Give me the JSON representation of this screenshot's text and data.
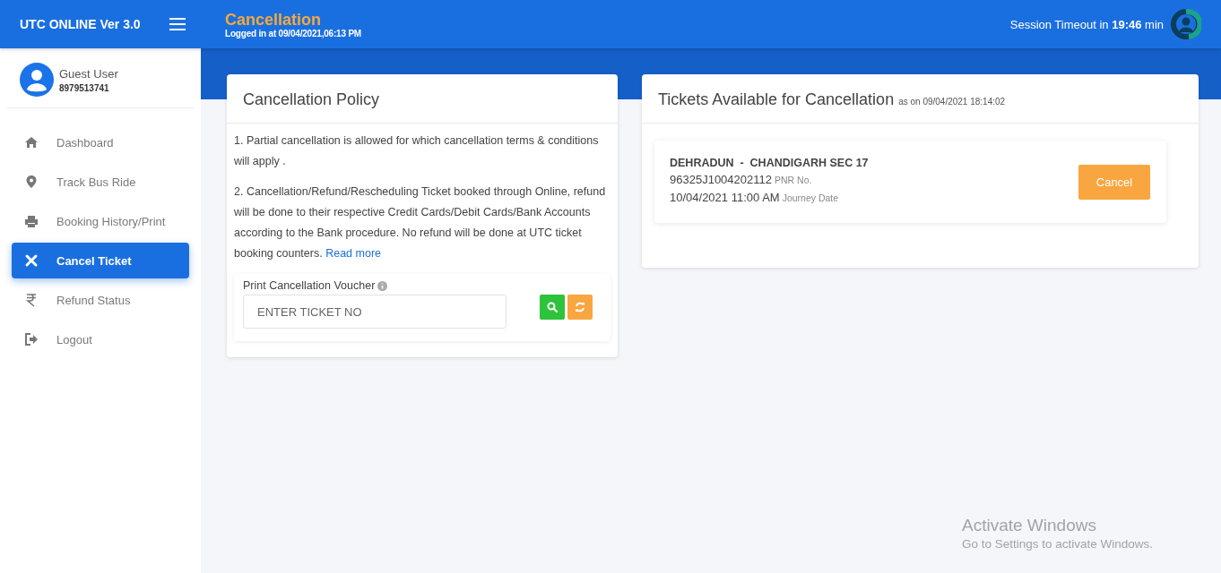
{
  "app": {
    "title": "UTC ONLINE Ver 3.0"
  },
  "header": {
    "page_title": "Cancellation",
    "login_info": "Logged in at 09/04/2021,06:13 PM",
    "session": "Session Timeout in **19:46** min"
  },
  "user": {
    "name": "Guest User",
    "phone": "8979513741"
  },
  "sidebar": {
    "items": [
      {
        "label": "Dashboard",
        "selected": false
      },
      {
        "label": "Track Bus Ride",
        "selected": false
      },
      {
        "label": "Booking History/Print",
        "selected": false
      },
      {
        "label": "Cancel Ticket",
        "selected": true
      },
      {
        "label": "Refund Status",
        "selected": false
      },
      {
        "label": "Logout",
        "selected": false
      }
    ]
  },
  "policy": {
    "title": "Cancellation Policy",
    "paragraphs": [
      "1. Partial cancellation is allowed for which cancellation terms & conditions will apply .",
      "2. Cancellation/Refund/Rescheduling Ticket booked through Online, refund will be done to their respective Credit Cards/Debit Cards/Bank Accounts according to the Bank procedure. No refund will be done at UTC ticket booking counters."
    ],
    "link": "Read more",
    "voucher": {
      "label": "Print Cancellation Voucher",
      "placeholder": "ENTER TICKET NO"
    }
  },
  "tickets": {
    "title": "Tickets Available for Cancellation",
    "as_of": "as on 09/04/2021 18:14:02",
    "items": [
      {
        "route": "DEHRADUN  -  CHANDIGARH SEC 17",
        "pnr": "96325J1004202112",
        "pnr_label": "PNR No.",
        "date": "10/04/2021 11:00 AM",
        "date_label": "Journey Date",
        "button": "Cancel"
      }
    ]
  },
  "os_notice": {
    "title": "Activate Windows",
    "text": "Go to Settings to activate Windows."
  }
}
